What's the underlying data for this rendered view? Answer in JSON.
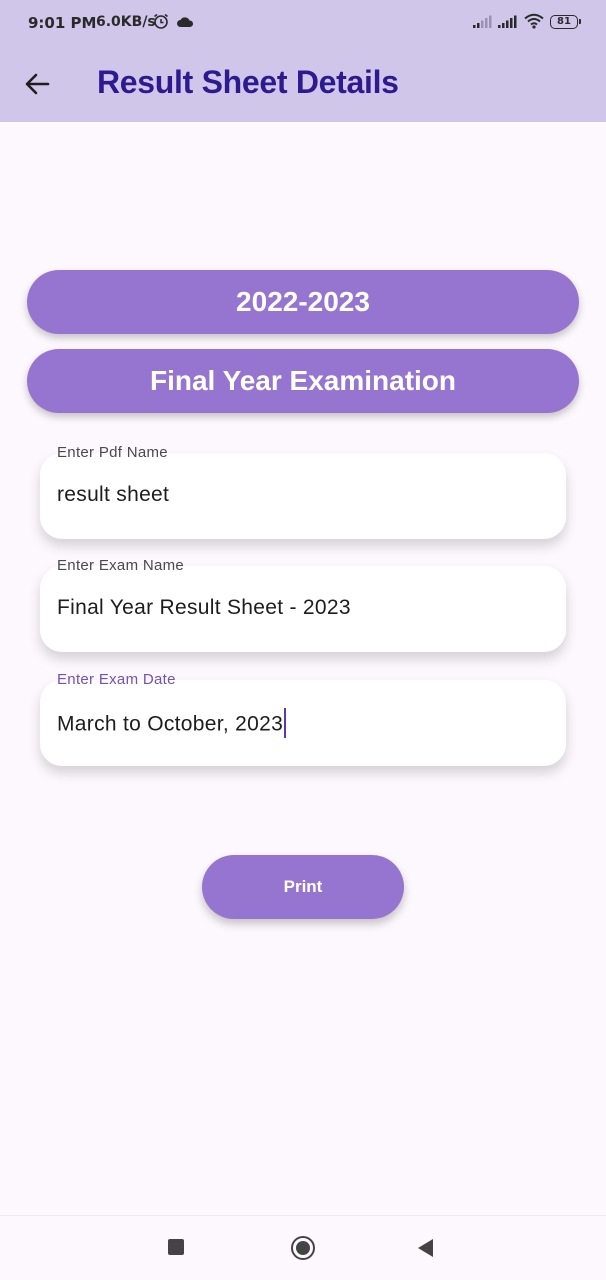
{
  "status_bar": {
    "time": "9:01 PM",
    "network_speed": "6.0KB/s",
    "battery": "81",
    "icons": [
      "alarm-icon",
      "cloud-icon",
      "signal-icon",
      "signal-icon",
      "wifi-icon",
      "battery-icon"
    ]
  },
  "app_bar": {
    "title": "Result Sheet Details",
    "back_icon": "arrow-left-icon"
  },
  "session": {
    "year": "2022-2023"
  },
  "exam": {
    "title": "Final Year Examination"
  },
  "form": {
    "pdf_name": {
      "label": "Enter Pdf Name",
      "value": "result sheet"
    },
    "exam_name": {
      "label": "Enter Exam Name",
      "value": "Final Year Result Sheet - 2023"
    },
    "exam_date": {
      "label": "Enter Exam Date",
      "value": "March to October, 2023"
    }
  },
  "actions": {
    "print_label": "Print"
  },
  "nav_bar": {
    "icons": [
      "recent-apps-icon",
      "home-icon",
      "back-icon"
    ]
  },
  "colors": {
    "app_bar_bg": "#d0c6ea",
    "title": "#2e1a8f",
    "accent": "#9675d0",
    "focus_label": "#7152b6",
    "page_bg": "#fdf8fd"
  }
}
